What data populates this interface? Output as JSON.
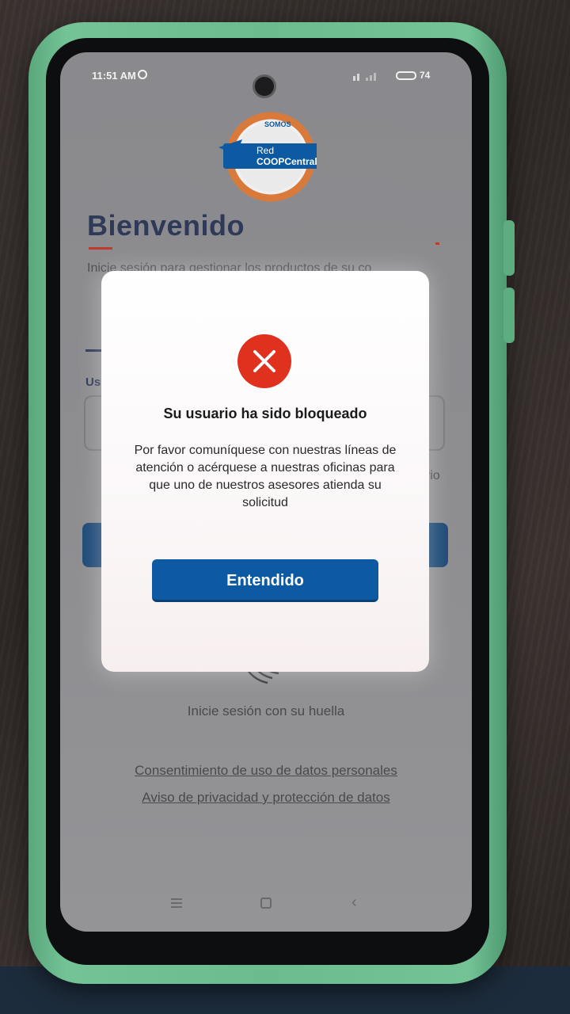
{
  "status_bar": {
    "time": "11:51 AM",
    "battery": "74"
  },
  "logo": {
    "top_text": "SOMOS",
    "line1": "Red",
    "line2": "COOPCentral"
  },
  "login": {
    "welcome_title": "Bienvenido",
    "subtitle": "Inicie sesión para gestionar los productos de su co",
    "user_label_fragment": "Us",
    "forgot_fragment": "rio",
    "fingerprint_text": "Inicie sesión con su huella",
    "consent_link": "Consentimiento de uso de datos personales",
    "privacy_link": "Aviso de privacidad y protección de datos"
  },
  "modal": {
    "title": "Su usuario ha sido bloqueado",
    "message": "Por favor comuníquese con nuestras líneas de atención o acérquese a nuestras oficinas para que uno de nuestros asesores atienda su solicitud",
    "button_label": "Entendido"
  },
  "colors": {
    "brand_blue": "#0d5aa3",
    "error_red": "#e0301e",
    "title_navy": "#2e3a57"
  },
  "icons": {
    "error": "close-circle-icon",
    "fingerprint": "fingerprint-icon",
    "nav_menu": "menu-icon",
    "nav_home": "home-icon",
    "nav_back": "back-icon"
  }
}
